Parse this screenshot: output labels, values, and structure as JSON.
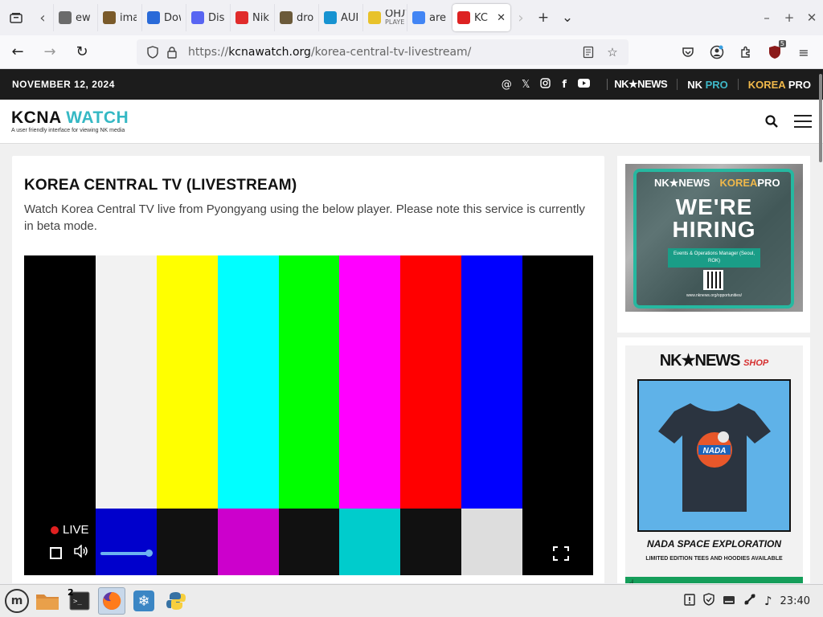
{
  "browser": {
    "tabs": [
      {
        "title": "ew",
        "favicon": "pin-icon",
        "color": "#6b6b6b"
      },
      {
        "title": "imag",
        "favicon": "image-icon",
        "color": "#7a5a2a"
      },
      {
        "title": "Dow",
        "favicon": "download-icon",
        "color": "#2a6ad8"
      },
      {
        "title": "Disc",
        "favicon": "discord-icon",
        "color": "#5865f2"
      },
      {
        "title": "Niki",
        "favicon": "niki-icon",
        "color": "#e02b2b"
      },
      {
        "title": "dro.j",
        "favicon": "dro-icon",
        "color": "#6b5a3a"
      },
      {
        "title": "AUR",
        "favicon": "arch-icon",
        "color": "#1793d1"
      },
      {
        "title": "ОНЛ",
        "subtitle": "PLAYE",
        "favicon": "player-icon",
        "color": "#e8c22a"
      },
      {
        "title": "are y",
        "favicon": "google-icon",
        "color": "#4285f4"
      },
      {
        "title": "KC",
        "favicon": "kcna-icon",
        "color": "#d22"
      }
    ],
    "url_prefix": "https://",
    "url_host": "kcnawatch.org",
    "url_path": "/korea-central-tv-livestream/",
    "extension_badge": "5"
  },
  "site": {
    "date": "NOVEMBER 12, 2024",
    "brands": {
      "nknews": "NK★NEWS",
      "nkpro_nk": "NK ",
      "nkpro_pro": "PRO",
      "koreapro_korea": "KOREA ",
      "koreapro_pro": "PRO"
    },
    "logo_kcna": "KCNA ",
    "logo_watch": "WATCH",
    "logo_tagline": "A user friendly interface for viewing NK media"
  },
  "article": {
    "title": "KOREA CENTRAL TV (LIVESTREAM)",
    "description": "Watch Korea Central TV live from Pyongyang using the below player. Please note this service is currently in beta mode."
  },
  "player": {
    "live_label": "LIVE",
    "volume_level": 1.0,
    "bars_top": [
      "#f2f2f2",
      "#ffff00",
      "#00ffff",
      "#00ff00",
      "#ff00ff",
      "#ff0000",
      "#0000ff"
    ],
    "bars_bottom": [
      "#0000cc",
      "#111111",
      "#cc00cc",
      "#111111",
      "#00cccc",
      "#111111",
      "#dddddd"
    ]
  },
  "ads": {
    "ad1_brand_nk": "NK★NEWS",
    "ad1_brand_korea": "KOREA",
    "ad1_brand_pro": "PRO",
    "ad1_hire_1": "WE'RE",
    "ad1_hire_2": "HIRING",
    "ad1_role": "Events & Operations Manager (Seoul, ROK)",
    "ad1_url": "www.nknews.org/opportunities/",
    "ad2_brand": "NK★NEWS",
    "ad2_shop": "SHOP",
    "ad2_caption": "NADA SPACE EXPLORATION",
    "ad2_sub": "LIMITED EDITION TEES AND HOODIES AVAILABLE",
    "tshirt_text": "NADA"
  },
  "taskbar": {
    "terminal_badge": "2",
    "clock": "23:40"
  }
}
